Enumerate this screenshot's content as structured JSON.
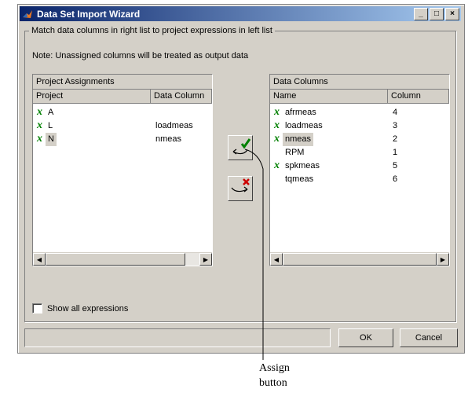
{
  "window": {
    "title": "Data Set Import Wizard",
    "controls": {
      "minimize": "_",
      "maximize": "□",
      "close": "×"
    }
  },
  "group_label": "Match data columns in right list to project expressions in left list",
  "note": "Note: Unassigned columns will be treated as output data",
  "left_panel": {
    "title": "Project Assignments",
    "headers": [
      "Project",
      "Data Column"
    ],
    "rows": [
      {
        "mark": "x",
        "project": "A",
        "data_column": ""
      },
      {
        "mark": "x",
        "project": "L",
        "data_column": "loadmeas"
      },
      {
        "mark": "x",
        "project": "N",
        "data_column": "nmeas"
      }
    ]
  },
  "right_panel": {
    "title": "Data Columns",
    "headers": [
      "Name",
      "Column"
    ],
    "rows": [
      {
        "mark": "x",
        "name": "afrmeas",
        "column": "4"
      },
      {
        "mark": "x",
        "name": "loadmeas",
        "column": "3"
      },
      {
        "mark": "x",
        "name": "nmeas",
        "column": "2"
      },
      {
        "mark": "",
        "name": "RPM",
        "column": "1"
      },
      {
        "mark": "x",
        "name": "spkmeas",
        "column": "5"
      },
      {
        "mark": "",
        "name": "tqmeas",
        "column": "6"
      }
    ]
  },
  "assign_button_icon": "assign-arrow-check-icon",
  "unassign_button_icon": "unassign-arrow-x-icon",
  "checkbox": {
    "label": "Show all expressions",
    "checked": false
  },
  "buttons": {
    "ok": "OK",
    "cancel": "Cancel"
  },
  "callout": {
    "line1": "Assign",
    "line2": "button"
  },
  "colors": {
    "title_start": "#0a246a",
    "title_end": "#a6caf0",
    "mark": "#008000",
    "unassign": "#cc0000"
  }
}
